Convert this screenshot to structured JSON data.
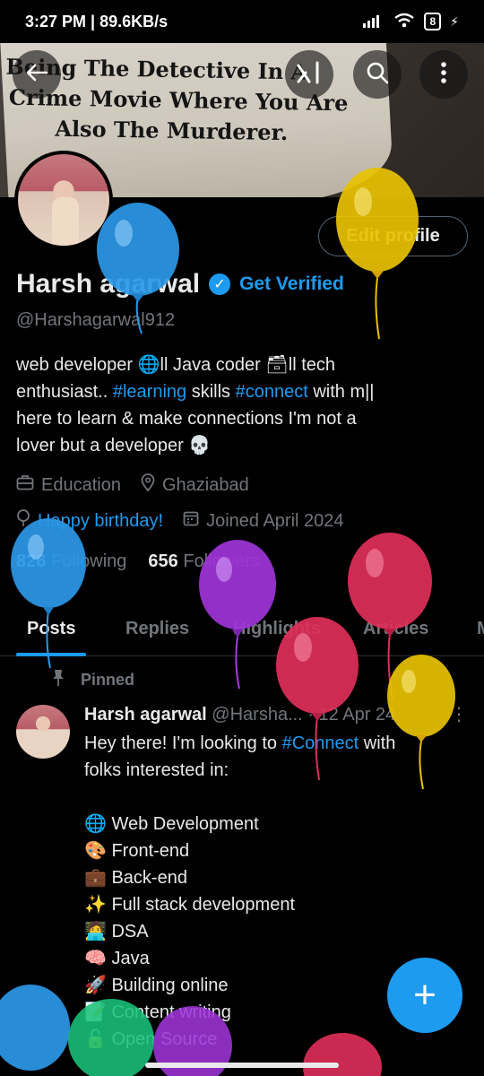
{
  "status_bar": {
    "time": "3:27 PM | 89.6KB/s",
    "battery": "8"
  },
  "banner": {
    "lines": [
      "Being The Detective In A",
      "Crime Movie Where You Are",
      "Also The Murderer."
    ]
  },
  "top_actions": {
    "back": "←",
    "xai": "x|",
    "search": "⌕",
    "more": "⋮"
  },
  "profile": {
    "edit_label": "Edit profile",
    "name": "Harsh agarwal",
    "get_verified": "Get Verified",
    "handle": "@Harshagarwal912",
    "bio": {
      "l1a": "web developer ",
      "l1b": "🌐ll Java coder ",
      "l1c": "🗃ll tech",
      "l2a": "enthusiast.. ",
      "l2_tag1": "#learning",
      "l2b": " skills ",
      "l2_tag2": "#connect",
      "l2c": " with m||",
      "l3": "here to learn & make connections  I'm not a",
      "l4": "lover but a developer 💀"
    },
    "category": "Education",
    "location": "Ghaziabad",
    "birthday": "Happy birthday!",
    "joined": "Joined April 2024",
    "following_count": "826",
    "following_label": "Following",
    "followers_count": "656",
    "followers_label": "Followers"
  },
  "tabs": [
    "Posts",
    "Replies",
    "Highlights",
    "Articles",
    "M"
  ],
  "pinned_post": {
    "pinned_label": "Pinned",
    "author": "Harsh agarwal",
    "handle": "@Harsha...",
    "date": "· 12 Apr 24",
    "more": "⋮",
    "lines": {
      "l1a": "Hey there! I'm looking to ",
      "l1_tag": "#Connect",
      "l1b": " with",
      "l2": "folks interested in:",
      "l3": "",
      "l4": "🌐 Web Development",
      "l5": "🎨 Front-end",
      "l6": "💼 Back-end",
      "l7": "✨ Full stack development",
      "l8": "🧑‍💻 DSA",
      "l9": "🧠 Java",
      "l10": "🚀 Building online",
      "l11": "📝 Content writing",
      "l12": "🔓 Open Source"
    }
  },
  "fab_label": "+",
  "colors": {
    "accent": "#1d9bf0",
    "background": "#000000",
    "muted": "#71767b",
    "text": "#e7e9ea"
  }
}
